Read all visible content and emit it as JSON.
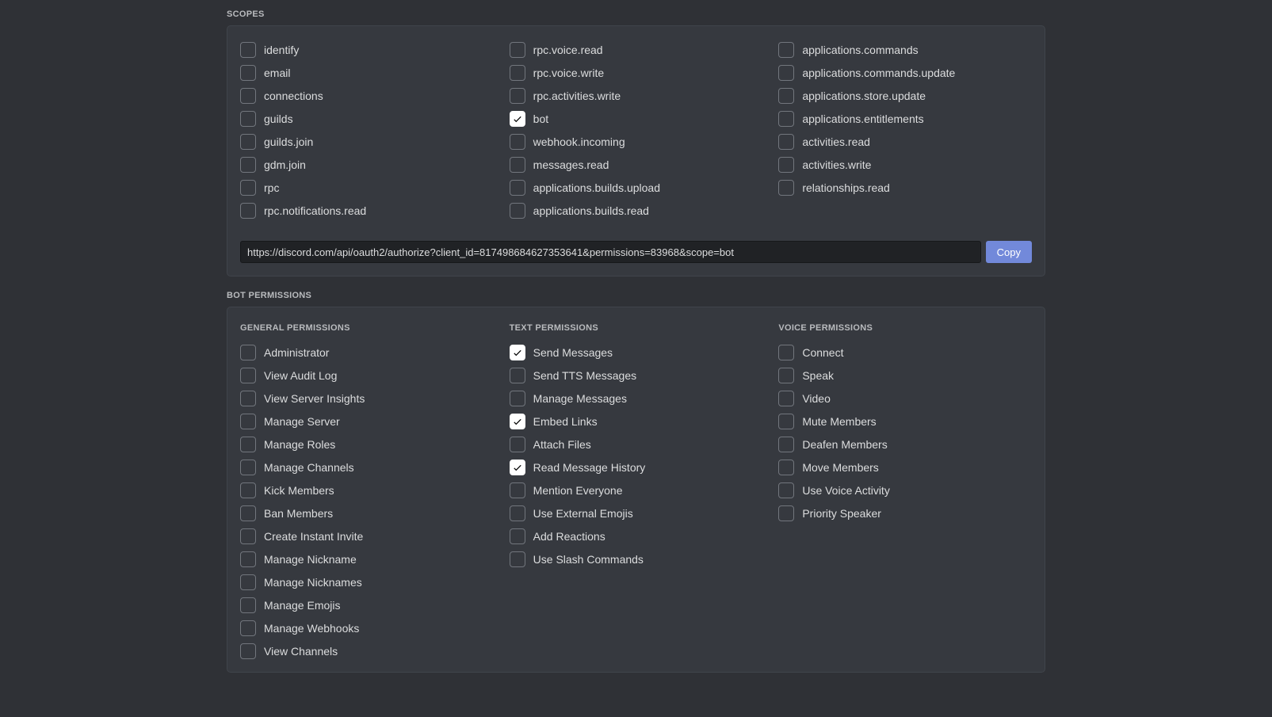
{
  "scopes": {
    "title": "SCOPES",
    "columns": [
      [
        {
          "label": "identify",
          "checked": false
        },
        {
          "label": "email",
          "checked": false
        },
        {
          "label": "connections",
          "checked": false
        },
        {
          "label": "guilds",
          "checked": false
        },
        {
          "label": "guilds.join",
          "checked": false
        },
        {
          "label": "gdm.join",
          "checked": false
        },
        {
          "label": "rpc",
          "checked": false
        },
        {
          "label": "rpc.notifications.read",
          "checked": false
        }
      ],
      [
        {
          "label": "rpc.voice.read",
          "checked": false
        },
        {
          "label": "rpc.voice.write",
          "checked": false
        },
        {
          "label": "rpc.activities.write",
          "checked": false
        },
        {
          "label": "bot",
          "checked": true
        },
        {
          "label": "webhook.incoming",
          "checked": false
        },
        {
          "label": "messages.read",
          "checked": false
        },
        {
          "label": "applications.builds.upload",
          "checked": false
        },
        {
          "label": "applications.builds.read",
          "checked": false
        }
      ],
      [
        {
          "label": "applications.commands",
          "checked": false
        },
        {
          "label": "applications.commands.update",
          "checked": false
        },
        {
          "label": "applications.store.update",
          "checked": false
        },
        {
          "label": "applications.entitlements",
          "checked": false
        },
        {
          "label": "activities.read",
          "checked": false
        },
        {
          "label": "activities.write",
          "checked": false
        },
        {
          "label": "relationships.read",
          "checked": false
        }
      ]
    ],
    "url": "https://discord.com/api/oauth2/authorize?client_id=817498684627353641&permissions=83968&scope=bot",
    "copy_label": "Copy"
  },
  "permissions": {
    "title": "BOT PERMISSIONS",
    "groups": [
      {
        "heading": "GENERAL PERMISSIONS",
        "items": [
          {
            "label": "Administrator",
            "checked": false
          },
          {
            "label": "View Audit Log",
            "checked": false
          },
          {
            "label": "View Server Insights",
            "checked": false
          },
          {
            "label": "Manage Server",
            "checked": false
          },
          {
            "label": "Manage Roles",
            "checked": false
          },
          {
            "label": "Manage Channels",
            "checked": false
          },
          {
            "label": "Kick Members",
            "checked": false
          },
          {
            "label": "Ban Members",
            "checked": false
          },
          {
            "label": "Create Instant Invite",
            "checked": false
          },
          {
            "label": "Manage Nickname",
            "checked": false
          },
          {
            "label": "Manage Nicknames",
            "checked": false
          },
          {
            "label": "Manage Emojis",
            "checked": false
          },
          {
            "label": "Manage Webhooks",
            "checked": false
          },
          {
            "label": "View Channels",
            "checked": false
          }
        ]
      },
      {
        "heading": "TEXT PERMISSIONS",
        "items": [
          {
            "label": "Send Messages",
            "checked": true
          },
          {
            "label": "Send TTS Messages",
            "checked": false
          },
          {
            "label": "Manage Messages",
            "checked": false
          },
          {
            "label": "Embed Links",
            "checked": true
          },
          {
            "label": "Attach Files",
            "checked": false
          },
          {
            "label": "Read Message History",
            "checked": true
          },
          {
            "label": "Mention Everyone",
            "checked": false
          },
          {
            "label": "Use External Emojis",
            "checked": false
          },
          {
            "label": "Add Reactions",
            "checked": false
          },
          {
            "label": "Use Slash Commands",
            "checked": false
          }
        ]
      },
      {
        "heading": "VOICE PERMISSIONS",
        "items": [
          {
            "label": "Connect",
            "checked": false
          },
          {
            "label": "Speak",
            "checked": false
          },
          {
            "label": "Video",
            "checked": false
          },
          {
            "label": "Mute Members",
            "checked": false
          },
          {
            "label": "Deafen Members",
            "checked": false
          },
          {
            "label": "Move Members",
            "checked": false
          },
          {
            "label": "Use Voice Activity",
            "checked": false
          },
          {
            "label": "Priority Speaker",
            "checked": false
          }
        ]
      }
    ]
  }
}
